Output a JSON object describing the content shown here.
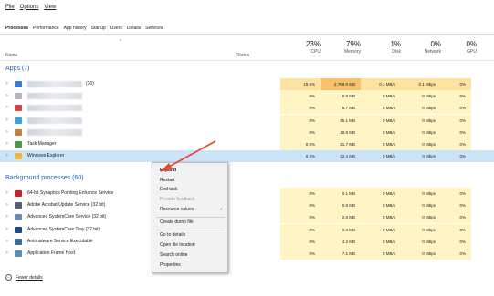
{
  "menu": [
    "File",
    "Options",
    "View"
  ],
  "tabs": [
    "Processes",
    "Performance",
    "App history",
    "Startup",
    "Users",
    "Details",
    "Services"
  ],
  "header": {
    "name": "Name",
    "status": "Status",
    "cpu": {
      "pct": "23%",
      "label": "CPU"
    },
    "memory": {
      "pct": "79%",
      "label": "Memory"
    },
    "disk": {
      "pct": "1%",
      "label": "Disk"
    },
    "network": {
      "pct": "0%",
      "label": "Network"
    },
    "gpu": {
      "pct": "0%",
      "label": "GPU"
    }
  },
  "apps_section": "Apps (7)",
  "apps": [
    {
      "name": "(30)",
      "cpu": "19.6%",
      "mem": "2,769.0 MB",
      "disk": "0.1 MB/s",
      "net": "0.1 Mbps",
      "gpu": "0%",
      "icon_color": "#3a7bd5"
    },
    {
      "name": "",
      "cpu": "0%",
      "mem": "0.8 MB",
      "disk": "0 MB/s",
      "net": "0 Mbps",
      "gpu": "0%",
      "icon_color": "#b0b6bc"
    },
    {
      "name": "",
      "cpu": "0%",
      "mem": "6.7 MB",
      "disk": "0 MB/s",
      "net": "0 Mbps",
      "gpu": "0%",
      "icon_color": "#e04040"
    },
    {
      "name": "",
      "cpu": "0%",
      "mem": "45.1 MB",
      "disk": "0 MB/s",
      "net": "0 Mbps",
      "gpu": "0%",
      "icon_color": "#3aa0e0"
    },
    {
      "name": "",
      "cpu": "0%",
      "mem": "18.9 MB",
      "disk": "0 MB/s",
      "net": "0 Mbps",
      "gpu": "0%",
      "icon_color": "#c08040"
    },
    {
      "name": "Task Manager",
      "cpu": "0.8%",
      "mem": "21.7 MB",
      "disk": "0 MB/s",
      "net": "0 Mbps",
      "gpu": "0%",
      "icon_color": "#4a9a4a"
    },
    {
      "name": "Windows Explorer",
      "cpu": "0.2%",
      "mem": "42.4 MB",
      "disk": "0 MB/s",
      "net": "0 Mbps",
      "gpu": "0%",
      "icon_color": "#e8b830"
    }
  ],
  "bg_section": "Background processes (60)",
  "bg": [
    {
      "name": "64-bit Synaptics Pointing Enhance Service",
      "cpu": "0%",
      "mem": "0.1 MB",
      "disk": "0 MB/s",
      "net": "0 Mbps",
      "gpu": "0%",
      "icon_color": "#d02020"
    },
    {
      "name": "Adobe Acrobat Update Service (32 bit)",
      "cpu": "0%",
      "mem": "0.8 MB",
      "disk": "0 MB/s",
      "net": "0 Mbps",
      "gpu": "0%",
      "icon_color": "#5a5a7a"
    },
    {
      "name": "Advanced SystemCare Service (32 bit)",
      "cpu": "0%",
      "mem": "2.6 MB",
      "disk": "0 MB/s",
      "net": "0 Mbps",
      "gpu": "0%",
      "icon_color": "#6a8ab0"
    },
    {
      "name": "Advanced SystemCare Tray (32 bit)",
      "cpu": "0%",
      "mem": "0.3 MB",
      "disk": "0 MB/s",
      "net": "0 Mbps",
      "gpu": "0%",
      "icon_color": "#1a4a8a"
    },
    {
      "name": "Antimalware Service Executable",
      "cpu": "0%",
      "mem": "4.2 MB",
      "disk": "0 MB/s",
      "net": "0 Mbps",
      "gpu": "0%",
      "icon_color": "#3a6a9a"
    },
    {
      "name": "Application Frame Host",
      "cpu": "0%",
      "mem": "7.1 MB",
      "disk": "0 MB/s",
      "net": "0 Mbps",
      "gpu": "0%",
      "icon_color": "#5a8ac0"
    }
  ],
  "context_menu": [
    "Expand",
    "Restart",
    "End task",
    "Provide feedback",
    "Resource values",
    "Create dump file",
    "Go to details",
    "Open file location",
    "Search online",
    "Properties"
  ],
  "footer": "Fewer details",
  "accent": "#e8452c"
}
